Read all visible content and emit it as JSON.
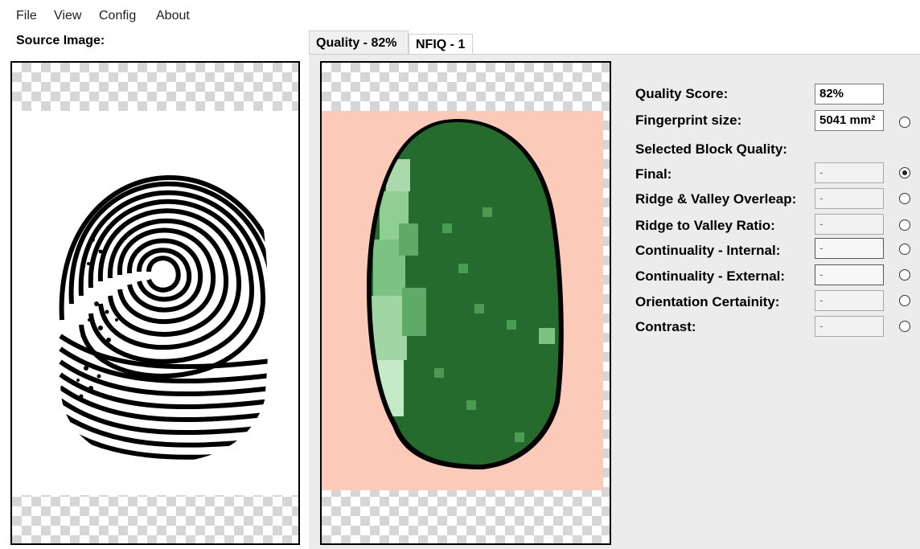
{
  "menu": {
    "items": [
      "File",
      "View",
      "Config",
      "About"
    ]
  },
  "source": {
    "label": "Source Image:"
  },
  "tabs": [
    {
      "label": "Quality - 82%",
      "selected": true
    },
    {
      "label": "NFIQ - 1",
      "selected": false
    }
  ],
  "quality_panel": {
    "quality_score_label": "Quality Score:",
    "quality_score_value": "82%",
    "fingerprint_size_label": "Fingerprint size:",
    "fingerprint_size_value": "5041 mm²",
    "selected_block_label": "Selected Block Quality:",
    "metrics": [
      {
        "label": "Final:",
        "value": "-",
        "selected": true
      },
      {
        "label": "Ridge & Valley Overleap:",
        "value": "-",
        "selected": false
      },
      {
        "label": "Ridge to Valley Ratio:",
        "value": "-",
        "selected": false
      },
      {
        "label": "Continuality - Internal:",
        "value": "-",
        "selected": false
      },
      {
        "label": "Continuality - External:",
        "value": "-",
        "selected": false
      },
      {
        "label": "Orientation Certainity:",
        "value": "-",
        "selected": false
      },
      {
        "label": "Contrast:",
        "value": "-",
        "selected": false
      }
    ]
  },
  "colors": {
    "quality_background": "#fccab9",
    "fingerprint_dark_green": "#256b2e",
    "fingerprint_light_green": "#c6e9c8"
  }
}
